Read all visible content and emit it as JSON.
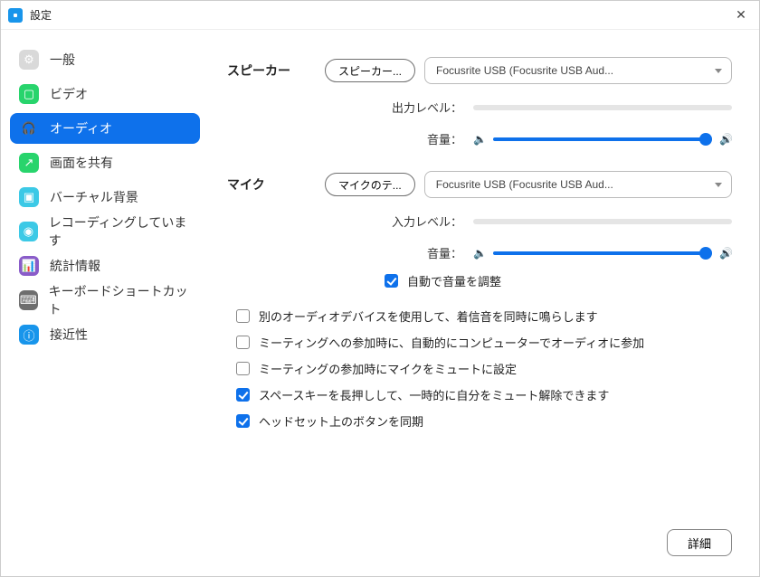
{
  "window": {
    "title": "設定"
  },
  "sidebar": {
    "items": [
      {
        "label": "一般",
        "icon_bg": "#d9d9d9",
        "glyph": "⚙"
      },
      {
        "label": "ビデオ",
        "icon_bg": "#28d46c",
        "glyph": "▢"
      },
      {
        "label": "オーディオ",
        "icon_bg": "#0e71eb",
        "glyph": "🎧"
      },
      {
        "label": "画面を共有",
        "icon_bg": "#28d46c",
        "glyph": "↗"
      },
      {
        "label": "バーチャル背景",
        "icon_bg": "#3cc9e6",
        "glyph": "▣"
      },
      {
        "label": "レコーディングしています",
        "icon_bg": "#3cc9e6",
        "glyph": "◉"
      },
      {
        "label": "統計情報",
        "icon_bg": "#8a5cc9",
        "glyph": "📊"
      },
      {
        "label": "キーボードショートカット",
        "icon_bg": "#6e6e6e",
        "glyph": "⌨"
      },
      {
        "label": "接近性",
        "icon_bg": "#1895eb",
        "glyph": "ⓘ"
      }
    ],
    "active_index": 2
  },
  "speaker": {
    "title": "スピーカー",
    "test_btn": "スピーカー...",
    "device": "Focusrite USB (Focusrite USB Aud...",
    "output_level_label": "出力レベル：",
    "volume_label": "音量："
  },
  "mic": {
    "title": "マイク",
    "test_btn": "マイクのテ...",
    "device": "Focusrite USB (Focusrite USB Aud...",
    "input_level_label": "入力レベル：",
    "volume_label": "音量：",
    "auto_adjust": {
      "label": "自動で音量を調整",
      "checked": true
    }
  },
  "options": [
    {
      "label": "別のオーディオデバイスを使用して、着信音を同時に鳴らします",
      "checked": false
    },
    {
      "label": "ミーティングへの参加時に、自動的にコンピューターでオーディオに参加",
      "checked": false
    },
    {
      "label": "ミーティングの参加時にマイクをミュートに設定",
      "checked": false
    },
    {
      "label": "スペースキーを長押しして、一時的に自分をミュート解除できます",
      "checked": true
    },
    {
      "label": "ヘッドセット上のボタンを同期",
      "checked": true
    }
  ],
  "footer": {
    "advanced": "詳細"
  }
}
